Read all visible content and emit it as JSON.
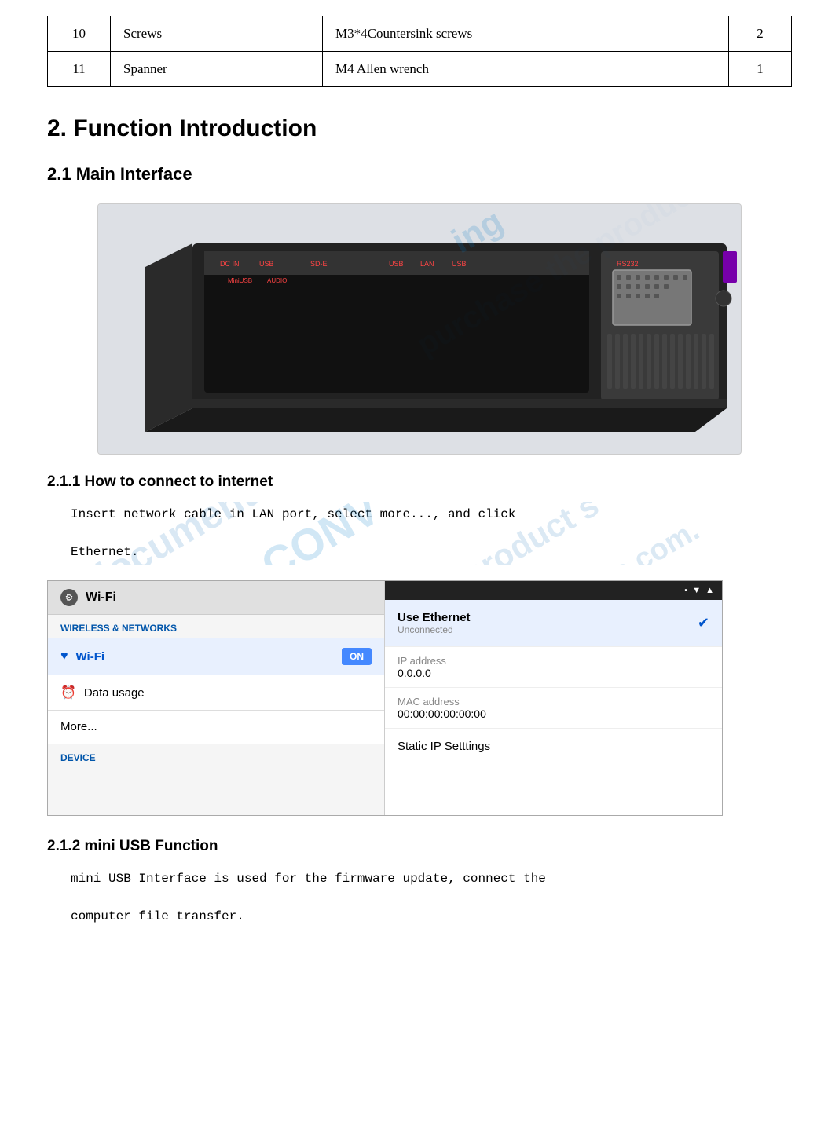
{
  "table": {
    "rows": [
      {
        "number": "10",
        "name": "Screws",
        "description": "M3*4Countersink screws",
        "quantity": "2"
      },
      {
        "number": "11",
        "name": "Spanner",
        "description": "M4 Allen wrench",
        "quantity": "1"
      }
    ]
  },
  "section2": {
    "heading": "2. Function Introduction",
    "subsection21": {
      "heading": "2.1 Main Interface"
    },
    "subsection211": {
      "heading": "2.1.1 How to connect to internet",
      "body_line1": "Insert network cable in LAN port, select more..., and click",
      "body_line2": "Ethernet."
    },
    "subsection212": {
      "heading": "2.1.2 mini USB Function",
      "body_line1": "mini USB Interface is used for the firmware update, connect the",
      "body_line2": "computer file transfer."
    }
  },
  "wifi_screenshot": {
    "header_icon": "⚙",
    "header_title": "Wi-Fi",
    "wireless_label": "WIRELESS & NETWORKS",
    "wifi_label": "Wi-Fi",
    "toggle_label": "ON",
    "data_usage_label": "Data usage",
    "more_label": "More...",
    "device_label": "DEVICE"
  },
  "ethernet_screenshot": {
    "status_icons": [
      "□",
      "▼"
    ],
    "use_ethernet_label": "Use Ethernet",
    "unconnected_label": "Unconnected",
    "ip_address_label": "IP address",
    "ip_address_value": "0.0.0.0",
    "mac_address_label": "MAC address",
    "mac_address_value": "00:00:00:00:00:00",
    "static_ip_label": "Static IP Setttings"
  },
  "watermark": {
    "line1": "documentwa...",
    "line2": "ID CONV",
    "line3": "hase the product s",
    "line4": "lidDocum...ents.com."
  }
}
